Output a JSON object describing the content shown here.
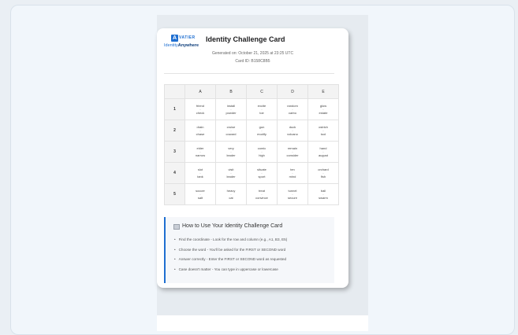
{
  "card": {
    "logo_mark": "A",
    "logo_word": "VATIER",
    "logo_sub_a": "Identity",
    "logo_sub_b": "Anywhere",
    "title": "Identity Challenge Card",
    "generated": "Generated on: October 21, 2025 at 23:25 UTC",
    "card_id": "Card ID: B158C8B5"
  },
  "grid": {
    "columns": [
      "A",
      "B",
      "C",
      "D",
      "E"
    ],
    "rows": [
      {
        "label": "1",
        "cells": [
          [
            "friend",
            "check"
          ],
          [
            "install",
            "powder"
          ],
          [
            "excite",
            "toe"
          ],
          [
            "random",
            "carbo"
          ],
          [
            "glow",
            "estate"
          ]
        ]
      },
      {
        "label": "2",
        "cells": [
          [
            "drain",
            "chase"
          ],
          [
            "cruise",
            "coward"
          ],
          [
            "gun",
            "modify"
          ],
          [
            "duck",
            "volcano"
          ],
          [
            "ostrich",
            "tool"
          ]
        ]
      },
      {
        "label": "3",
        "cells": [
          [
            "elder",
            "narrow"
          ],
          [
            "very",
            "leader"
          ],
          [
            "comic",
            "high"
          ],
          [
            "remain",
            "consider"
          ],
          [
            "hand",
            "august"
          ]
        ]
      },
      {
        "label": "4",
        "cells": [
          [
            "slot",
            "tank"
          ],
          [
            "visit",
            "leader"
          ],
          [
            "situate",
            "sport"
          ],
          [
            "ten",
            "mind"
          ],
          [
            "orchard",
            "fish"
          ]
        ]
      },
      {
        "label": "5",
        "cells": [
          [
            "soccer",
            "salt"
          ],
          [
            "heavy",
            "cat"
          ],
          [
            "treat",
            "convince"
          ],
          [
            "tunnel",
            "secure"
          ],
          [
            "ball",
            "swarm"
          ]
        ]
      }
    ]
  },
  "howto": {
    "title": "How to Use Your Identity Challenge Card",
    "items": [
      "Find the coordinate - Look for the row and column (e.g., A1, B3, E5)",
      "Choose the word - You'll be asked for the FIRST or SECOND word",
      "Answer correctly - Enter the FIRST or SECOND word as requested",
      "Case doesn't matter - You can type in uppercase or lowercase"
    ]
  }
}
